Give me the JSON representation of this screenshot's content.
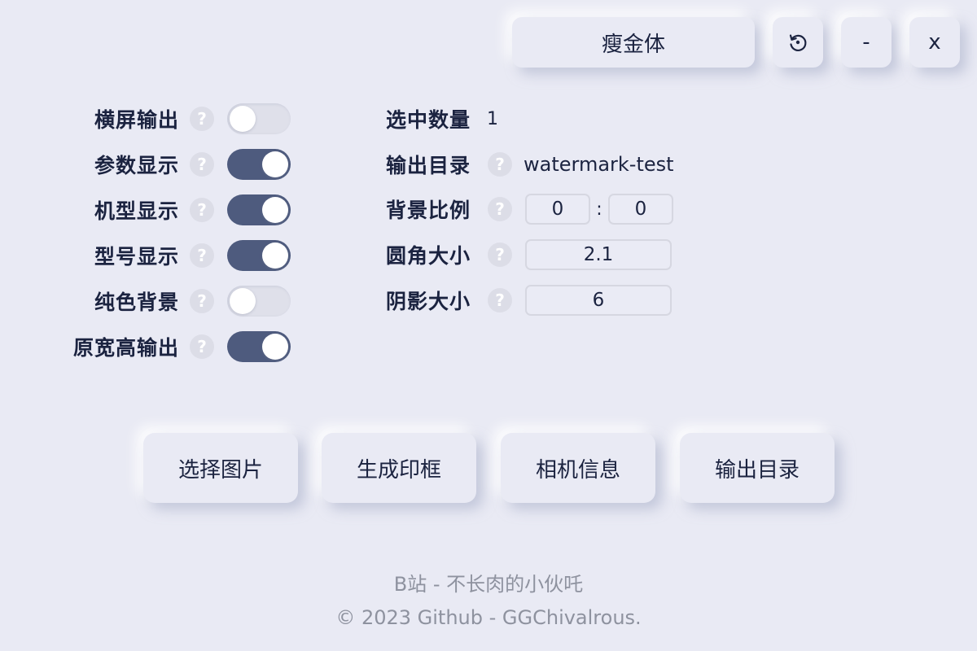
{
  "topbar": {
    "font_label": "瘦金体",
    "minimize_label": "-",
    "close_label": "x"
  },
  "settings": {
    "help_glyph": "?",
    "items": [
      {
        "label": "横屏输出",
        "on": false
      },
      {
        "label": "参数显示",
        "on": true
      },
      {
        "label": "机型显示",
        "on": true
      },
      {
        "label": "型号显示",
        "on": true
      },
      {
        "label": "纯色背景",
        "on": false
      },
      {
        "label": "原宽高输出",
        "on": true
      }
    ]
  },
  "info": {
    "selected_count_label": "选中数量",
    "selected_count_value": "1",
    "output_dir_label": "输出目录",
    "output_dir_value": "watermark-test",
    "bg_ratio_label": "背景比例",
    "bg_ratio_a": "0",
    "bg_ratio_sep": ":",
    "bg_ratio_b": "0",
    "corner_label": "圆角大小",
    "corner_value": "2.1",
    "shadow_label": "阴影大小",
    "shadow_value": "6"
  },
  "actions": {
    "select_images": "选择图片",
    "generate_frame": "生成印框",
    "camera_info": "相机信息",
    "output_dir": "输出目录"
  },
  "footer": {
    "line1": "B站 - 不长肉的小伙吒",
    "line2": "© 2023 Github - GGChivalrous."
  },
  "colors": {
    "background": "#e9eaf4",
    "toggle_on": "#4e5b7e",
    "toggle_off": "#dfe0ea",
    "text": "#1b2340",
    "footer_text": "#8e929f"
  },
  "icons": {
    "reset": "reset-icon",
    "help": "help-icon"
  }
}
